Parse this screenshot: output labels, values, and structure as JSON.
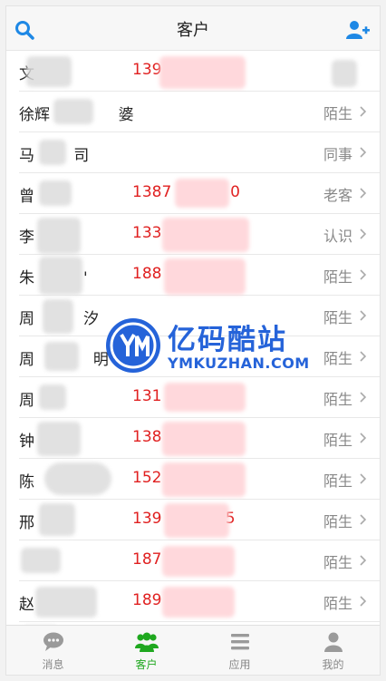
{
  "header": {
    "title": "客户"
  },
  "contacts": [
    {
      "name": "文",
      "phone": "139",
      "relation": ""
    },
    {
      "name": "徐辉",
      "phone": "",
      "relation": "陌生"
    },
    {
      "name": "马",
      "phone": "",
      "relation": "同事"
    },
    {
      "name": "曾",
      "phone": "1387",
      "relation": "老客"
    },
    {
      "name": "李",
      "phone": "133",
      "relation": "认识"
    },
    {
      "name": "朱",
      "phone": "188",
      "relation": "陌生"
    },
    {
      "name": "周",
      "phone": "",
      "relation": "陌生"
    },
    {
      "name": "周",
      "phone": "",
      "relation": "陌生"
    },
    {
      "name": "周",
      "phone": "131",
      "relation": "陌生"
    },
    {
      "name": "钟",
      "phone": "138",
      "relation": "陌生"
    },
    {
      "name": "陈",
      "phone": "152",
      "relation": "陌生"
    },
    {
      "name": "邢",
      "phone": "139",
      "relation": "陌生"
    },
    {
      "name": "",
      "phone": "187",
      "relation": "陌生"
    },
    {
      "name": "赵",
      "phone": "189",
      "relation": "陌生"
    },
    {
      "name": "",
      "phone": "",
      "relation": ""
    }
  ],
  "watermark": {
    "title": "亿码酷站",
    "subtitle": "YMKUZHAN.COM"
  },
  "tabs": [
    {
      "label": "消息",
      "icon": "chat-icon",
      "active": false
    },
    {
      "label": "客户",
      "icon": "group-icon",
      "active": true
    },
    {
      "label": "应用",
      "icon": "menu-icon",
      "active": false
    },
    {
      "label": "我的",
      "icon": "user-icon",
      "active": false
    }
  ],
  "colors": {
    "accent": "#1e88e5",
    "phone": "#e02020",
    "active_tab": "#1fa81f",
    "watermark": "#2563d9"
  }
}
